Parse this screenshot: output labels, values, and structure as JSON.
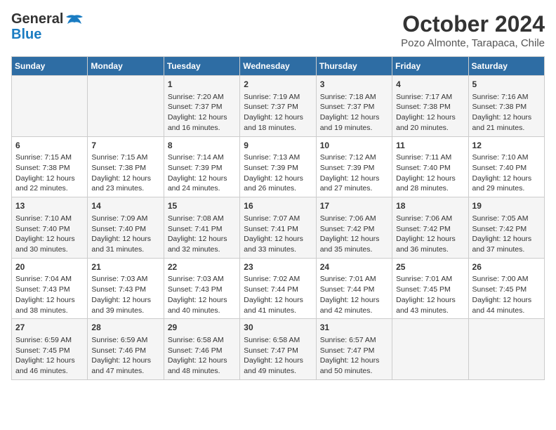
{
  "header": {
    "logo_general": "General",
    "logo_blue": "Blue",
    "month_title": "October 2024",
    "location": "Pozo Almonte, Tarapaca, Chile"
  },
  "calendar": {
    "headers": [
      "Sunday",
      "Monday",
      "Tuesday",
      "Wednesday",
      "Thursday",
      "Friday",
      "Saturday"
    ],
    "weeks": [
      [
        {
          "day": "",
          "sunrise": "",
          "sunset": "",
          "daylight": ""
        },
        {
          "day": "",
          "sunrise": "",
          "sunset": "",
          "daylight": ""
        },
        {
          "day": "1",
          "sunrise": "Sunrise: 7:20 AM",
          "sunset": "Sunset: 7:37 PM",
          "daylight": "Daylight: 12 hours and 16 minutes."
        },
        {
          "day": "2",
          "sunrise": "Sunrise: 7:19 AM",
          "sunset": "Sunset: 7:37 PM",
          "daylight": "Daylight: 12 hours and 18 minutes."
        },
        {
          "day": "3",
          "sunrise": "Sunrise: 7:18 AM",
          "sunset": "Sunset: 7:37 PM",
          "daylight": "Daylight: 12 hours and 19 minutes."
        },
        {
          "day": "4",
          "sunrise": "Sunrise: 7:17 AM",
          "sunset": "Sunset: 7:38 PM",
          "daylight": "Daylight: 12 hours and 20 minutes."
        },
        {
          "day": "5",
          "sunrise": "Sunrise: 7:16 AM",
          "sunset": "Sunset: 7:38 PM",
          "daylight": "Daylight: 12 hours and 21 minutes."
        }
      ],
      [
        {
          "day": "6",
          "sunrise": "Sunrise: 7:15 AM",
          "sunset": "Sunset: 7:38 PM",
          "daylight": "Daylight: 12 hours and 22 minutes."
        },
        {
          "day": "7",
          "sunrise": "Sunrise: 7:15 AM",
          "sunset": "Sunset: 7:38 PM",
          "daylight": "Daylight: 12 hours and 23 minutes."
        },
        {
          "day": "8",
          "sunrise": "Sunrise: 7:14 AM",
          "sunset": "Sunset: 7:39 PM",
          "daylight": "Daylight: 12 hours and 24 minutes."
        },
        {
          "day": "9",
          "sunrise": "Sunrise: 7:13 AM",
          "sunset": "Sunset: 7:39 PM",
          "daylight": "Daylight: 12 hours and 26 minutes."
        },
        {
          "day": "10",
          "sunrise": "Sunrise: 7:12 AM",
          "sunset": "Sunset: 7:39 PM",
          "daylight": "Daylight: 12 hours and 27 minutes."
        },
        {
          "day": "11",
          "sunrise": "Sunrise: 7:11 AM",
          "sunset": "Sunset: 7:40 PM",
          "daylight": "Daylight: 12 hours and 28 minutes."
        },
        {
          "day": "12",
          "sunrise": "Sunrise: 7:10 AM",
          "sunset": "Sunset: 7:40 PM",
          "daylight": "Daylight: 12 hours and 29 minutes."
        }
      ],
      [
        {
          "day": "13",
          "sunrise": "Sunrise: 7:10 AM",
          "sunset": "Sunset: 7:40 PM",
          "daylight": "Daylight: 12 hours and 30 minutes."
        },
        {
          "day": "14",
          "sunrise": "Sunrise: 7:09 AM",
          "sunset": "Sunset: 7:40 PM",
          "daylight": "Daylight: 12 hours and 31 minutes."
        },
        {
          "day": "15",
          "sunrise": "Sunrise: 7:08 AM",
          "sunset": "Sunset: 7:41 PM",
          "daylight": "Daylight: 12 hours and 32 minutes."
        },
        {
          "day": "16",
          "sunrise": "Sunrise: 7:07 AM",
          "sunset": "Sunset: 7:41 PM",
          "daylight": "Daylight: 12 hours and 33 minutes."
        },
        {
          "day": "17",
          "sunrise": "Sunrise: 7:06 AM",
          "sunset": "Sunset: 7:42 PM",
          "daylight": "Daylight: 12 hours and 35 minutes."
        },
        {
          "day": "18",
          "sunrise": "Sunrise: 7:06 AM",
          "sunset": "Sunset: 7:42 PM",
          "daylight": "Daylight: 12 hours and 36 minutes."
        },
        {
          "day": "19",
          "sunrise": "Sunrise: 7:05 AM",
          "sunset": "Sunset: 7:42 PM",
          "daylight": "Daylight: 12 hours and 37 minutes."
        }
      ],
      [
        {
          "day": "20",
          "sunrise": "Sunrise: 7:04 AM",
          "sunset": "Sunset: 7:43 PM",
          "daylight": "Daylight: 12 hours and 38 minutes."
        },
        {
          "day": "21",
          "sunrise": "Sunrise: 7:03 AM",
          "sunset": "Sunset: 7:43 PM",
          "daylight": "Daylight: 12 hours and 39 minutes."
        },
        {
          "day": "22",
          "sunrise": "Sunrise: 7:03 AM",
          "sunset": "Sunset: 7:43 PM",
          "daylight": "Daylight: 12 hours and 40 minutes."
        },
        {
          "day": "23",
          "sunrise": "Sunrise: 7:02 AM",
          "sunset": "Sunset: 7:44 PM",
          "daylight": "Daylight: 12 hours and 41 minutes."
        },
        {
          "day": "24",
          "sunrise": "Sunrise: 7:01 AM",
          "sunset": "Sunset: 7:44 PM",
          "daylight": "Daylight: 12 hours and 42 minutes."
        },
        {
          "day": "25",
          "sunrise": "Sunrise: 7:01 AM",
          "sunset": "Sunset: 7:45 PM",
          "daylight": "Daylight: 12 hours and 43 minutes."
        },
        {
          "day": "26",
          "sunrise": "Sunrise: 7:00 AM",
          "sunset": "Sunset: 7:45 PM",
          "daylight": "Daylight: 12 hours and 44 minutes."
        }
      ],
      [
        {
          "day": "27",
          "sunrise": "Sunrise: 6:59 AM",
          "sunset": "Sunset: 7:45 PM",
          "daylight": "Daylight: 12 hours and 46 minutes."
        },
        {
          "day": "28",
          "sunrise": "Sunrise: 6:59 AM",
          "sunset": "Sunset: 7:46 PM",
          "daylight": "Daylight: 12 hours and 47 minutes."
        },
        {
          "day": "29",
          "sunrise": "Sunrise: 6:58 AM",
          "sunset": "Sunset: 7:46 PM",
          "daylight": "Daylight: 12 hours and 48 minutes."
        },
        {
          "day": "30",
          "sunrise": "Sunrise: 6:58 AM",
          "sunset": "Sunset: 7:47 PM",
          "daylight": "Daylight: 12 hours and 49 minutes."
        },
        {
          "day": "31",
          "sunrise": "Sunrise: 6:57 AM",
          "sunset": "Sunset: 7:47 PM",
          "daylight": "Daylight: 12 hours and 50 minutes."
        },
        {
          "day": "",
          "sunrise": "",
          "sunset": "",
          "daylight": ""
        },
        {
          "day": "",
          "sunrise": "",
          "sunset": "",
          "daylight": ""
        }
      ]
    ]
  }
}
